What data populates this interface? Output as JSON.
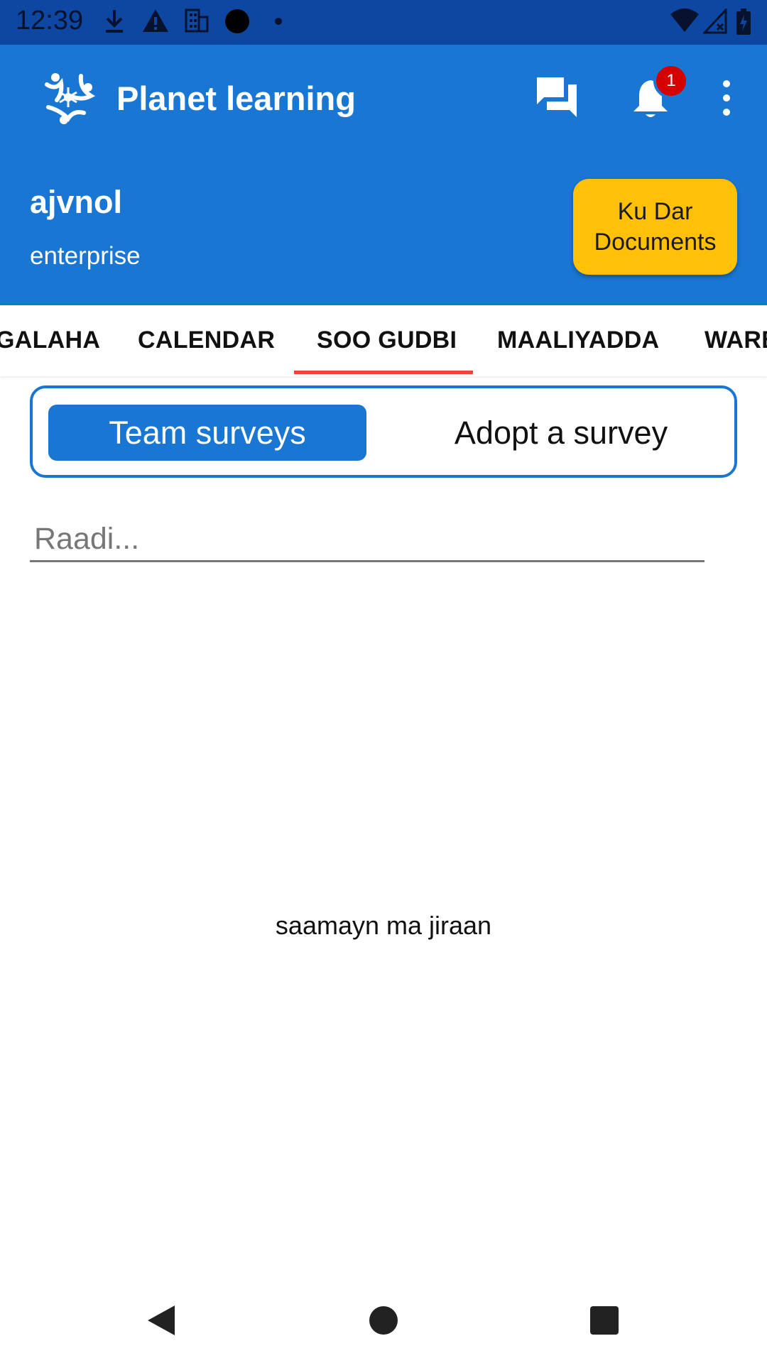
{
  "status_bar": {
    "time": "12:39",
    "left_icons": [
      "download-icon",
      "warning-icon",
      "building-icon",
      "dot-filled-icon",
      "small-dot-icon"
    ],
    "right_icons": [
      "wifi-icon",
      "signal-icon",
      "battery-charging-icon"
    ]
  },
  "app_bar": {
    "title": "Planet learning",
    "notification_count": "1",
    "colors": {
      "primary": "#1976d2",
      "status": "#0d47a1",
      "accent": "#ffc107",
      "badge": "#d50000"
    }
  },
  "user": {
    "name": "ajvnol",
    "role": "enterprise",
    "documents_button": "Ku Dar Documents"
  },
  "tabs": [
    {
      "label": "GALAHA"
    },
    {
      "label": "CALENDAR"
    },
    {
      "label": "SOO GUDBI",
      "selected": true
    },
    {
      "label": "MAALIYADDA"
    },
    {
      "label": "WARBIXINO"
    }
  ],
  "survey_toggle": {
    "active": "Team surveys",
    "inactive": "Adopt a survey"
  },
  "search": {
    "placeholder": "Raadi..."
  },
  "empty_message": "saamayn ma jiraan",
  "nav": [
    "back-icon",
    "home-icon",
    "recents-icon"
  ]
}
